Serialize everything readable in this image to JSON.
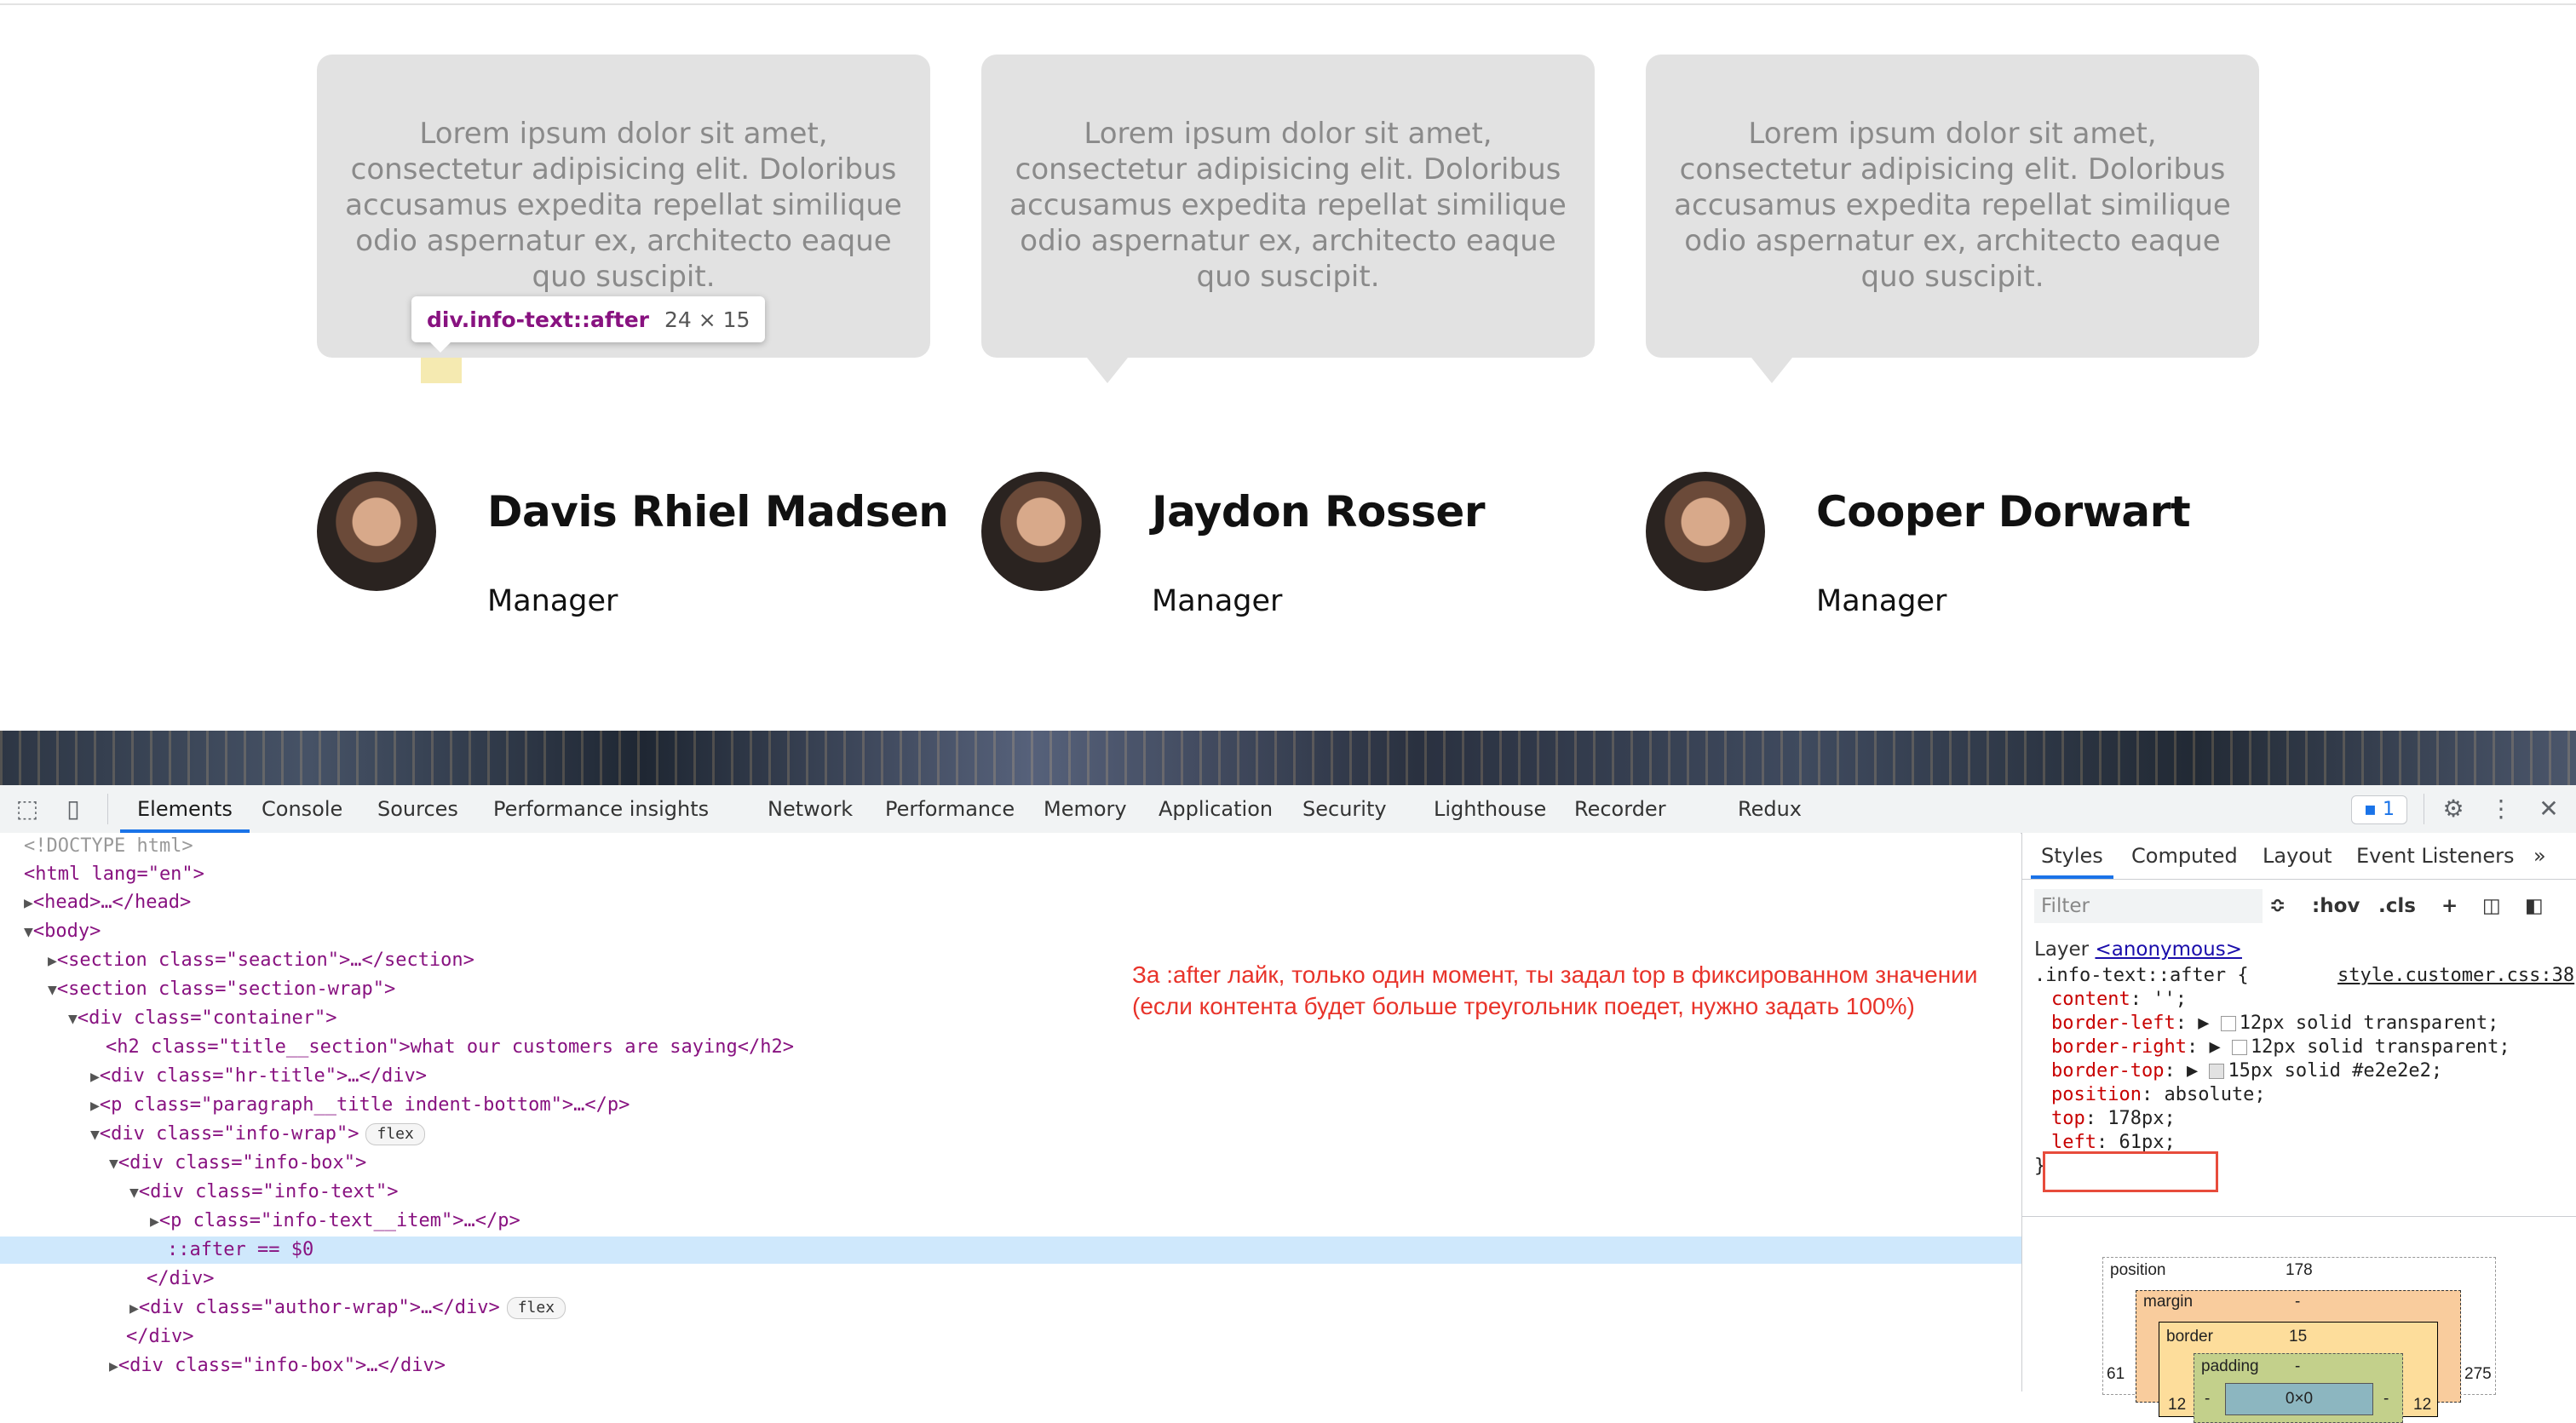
{
  "page": {
    "cards": [
      {
        "text": "Lorem ipsum dolor sit amet, consectetur adipisicing elit. Doloribus accusamus expedita repellat similique odio aspernatur ex, architecto eaque quo suscipit."
      },
      {
        "text": "Lorem ipsum dolor sit amet, consectetur adipisicing elit. Doloribus accusamus expedita repellat similique odio aspernatur ex, architecto eaque quo suscipit."
      },
      {
        "text": "Lorem ipsum dolor sit amet, consectetur adipisicing elit. Doloribus accusamus expedita repellat similique odio aspernatur ex, architecto eaque quo suscipit."
      }
    ],
    "authors": [
      {
        "name": "Davis Rhiel Madsen",
        "role": "Manager"
      },
      {
        "name": "Jaydon Rosser",
        "role": "Manager"
      },
      {
        "name": "Cooper Dorwart",
        "role": "Manager"
      }
    ],
    "tooltip": {
      "selector": "div.info-text::after",
      "size": "24 × 15"
    }
  },
  "devtools": {
    "tabs": [
      "Elements",
      "Console",
      "Sources",
      "Performance insights",
      "Network",
      "Performance",
      "Memory",
      "Application",
      "Security",
      "Lighthouse",
      "Recorder",
      "Redux"
    ],
    "active_tab": "Elements",
    "issues_count": "1",
    "elements_lines": [
      "<!DOCTYPE html>",
      "<html lang=\"en\">",
      "<head>…</head>",
      "<body>",
      "<section class=\"seaction\">…</section>",
      "<section class=\"section-wrap\">",
      "<div class=\"container\">",
      "<h2 class=\"title__section\">what our customers are saying</h2>",
      "<div class=\"hr-title\">…</div>",
      "<p class=\"paragraph__title indent-bottom\">…</p>",
      "<div class=\"info-wrap\">",
      "<div class=\"info-box\">",
      "<div class=\"info-text\">",
      "<p class=\"info-text__item\">…</p>",
      "::after == $0",
      "</div>",
      "<div class=\"author-wrap\">…</div>",
      "</div>",
      "<div class=\"info-box\">…</div>"
    ],
    "flex_badge": "flex",
    "comment": "За :after лайк, только один момент, ты задал top в фиксированном значении (если контента будет больше треугольник поедет, нужно задать 100%)",
    "styles": {
      "tabs": [
        "Styles",
        "Computed",
        "Layout",
        "Event Listeners"
      ],
      "filter_placeholder": "Filter",
      "hov": ":hov",
      "cls": ".cls",
      "layer_label": "Layer",
      "layer_link": "<anonymous>",
      "selector": ".info-text::after {",
      "source": "style.customer.css:38",
      "props": [
        {
          "name": "content",
          "value": "'';"
        },
        {
          "name": "border-left",
          "value": "12px solid transparent;"
        },
        {
          "name": "border-right",
          "value": "12px solid transparent;"
        },
        {
          "name": "border-top",
          "value": "15px solid #e2e2e2;"
        },
        {
          "name": "position",
          "value": "absolute;"
        },
        {
          "name": "top",
          "value": "178px;"
        },
        {
          "name": "left",
          "value": "61px;"
        }
      ],
      "close_brace": "}",
      "box_model": {
        "position_label": "position",
        "position_top": "178",
        "position_left": "61",
        "position_right": "275",
        "margin_label": "margin",
        "margin_val": "-",
        "border_label": "border",
        "border_top": "15",
        "border_left": "12",
        "border_right": "12",
        "padding_label": "padding",
        "padding_val": "-",
        "padding_left": "-",
        "padding_right": "-",
        "content": "0×0"
      }
    }
  }
}
